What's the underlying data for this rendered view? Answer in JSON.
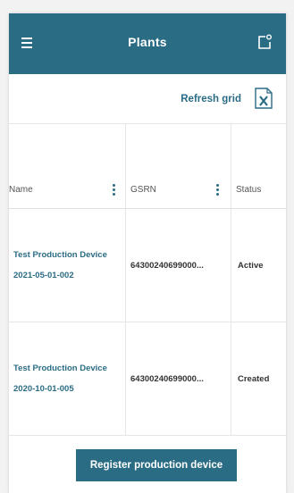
{
  "header": {
    "title": "Plants",
    "menu_icon": "hamburger-menu-icon",
    "popout_icon": "open-in-new-window-icon"
  },
  "toolbar": {
    "refresh_label": "Refresh grid",
    "export_icon": "excel-export-icon"
  },
  "grid": {
    "columns": [
      {
        "label": "Name"
      },
      {
        "label": "GSRN"
      },
      {
        "label": "Status"
      }
    ],
    "rows": [
      {
        "name": "Test Production Device 2021-05-01-002",
        "gsrn": "64300240699000...",
        "status": "Active"
      },
      {
        "name": "Test Production Device 2020-10-01-005",
        "gsrn": "64300240699000...",
        "status": "Created"
      }
    ]
  },
  "footer": {
    "register_label": "Register production device"
  },
  "colors": {
    "brand": "#2b6c85",
    "background": "#f2f2f2"
  }
}
